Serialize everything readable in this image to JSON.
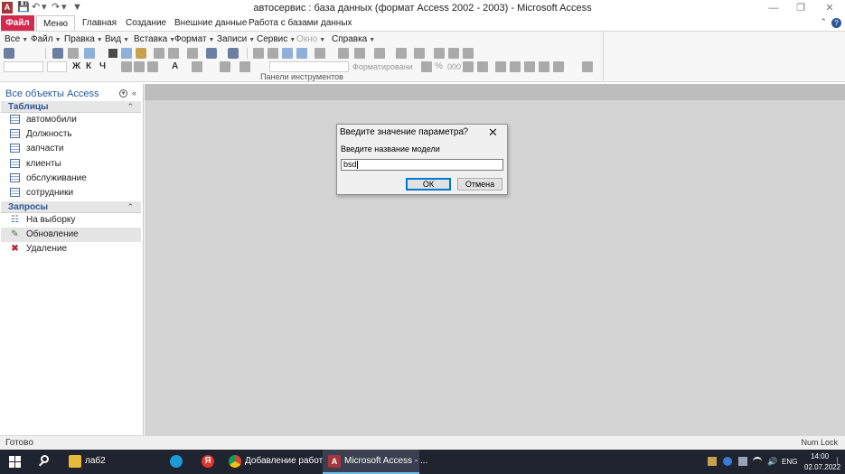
{
  "window": {
    "title": "автосервис : база данных (формат Access 2002 - 2003) - Microsoft Access",
    "app_icon_letter": "A"
  },
  "ribbon_tabs": [
    {
      "label": "Файл"
    },
    {
      "label": "Меню"
    },
    {
      "label": "Главная"
    },
    {
      "label": "Создание"
    },
    {
      "label": "Внешние данные"
    },
    {
      "label": "Работа с базами данных"
    }
  ],
  "menu_bar": [
    {
      "label": "Все"
    },
    {
      "label": "Файл"
    },
    {
      "label": "Правка"
    },
    {
      "label": "Вид"
    },
    {
      "label": "Вставка"
    },
    {
      "label": "Формат"
    },
    {
      "label": "Записи"
    },
    {
      "label": "Сервис"
    },
    {
      "label": "Окно"
    },
    {
      "label": "Справка"
    }
  ],
  "toolbar": {
    "format_label": "Форматировани",
    "bold": "Ж",
    "italic": "К",
    "underline": "Ч",
    "font_color": "А",
    "percent": "%",
    "thousands": "000"
  },
  "ribbon_group_label": "Панели инструментов",
  "nav_pane": {
    "title": "Все объекты Access",
    "groups": [
      {
        "label": "Таблицы",
        "items": [
          {
            "label": "автомобили"
          },
          {
            "label": "Должность"
          },
          {
            "label": "запчасти"
          },
          {
            "label": "клиенты"
          },
          {
            "label": "обслуживание"
          },
          {
            "label": "сотрудники"
          }
        ]
      },
      {
        "label": "Запросы",
        "items": [
          {
            "label": "На выборку"
          },
          {
            "label": "Обновление"
          },
          {
            "label": "Удаление"
          }
        ]
      }
    ]
  },
  "dialog": {
    "title": "Введите значение параметра",
    "help": "?",
    "prompt": "Введите название модели",
    "input_value": "bsd",
    "ok_label": "ОК",
    "cancel_label": "Отмена"
  },
  "status_bar": {
    "left": "Готово",
    "right": "Num Lock"
  },
  "taskbar": {
    "apps": [
      {
        "label": "лаб2"
      },
      {
        "label": ""
      },
      {
        "label": ""
      },
      {
        "label": "Добавление работ..."
      },
      {
        "label": "Microsoft Access - ..."
      }
    ],
    "language": "ENG",
    "time": "14:00",
    "date": "02.07.2022"
  }
}
